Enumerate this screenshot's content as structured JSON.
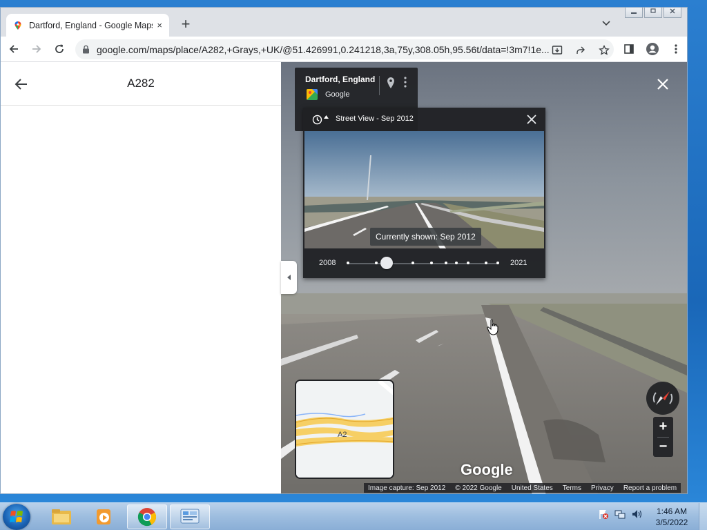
{
  "browser": {
    "tab": {
      "title": "Dartford, England - Google Maps",
      "close_icon": "×"
    },
    "new_tab_label": "+",
    "url": "google.com/maps/place/A282,+Grays,+UK/@51.426991,0.241218,3a,75y,308.05h,95.56t/data=!3m7!1e..."
  },
  "left_panel": {
    "title": "A282"
  },
  "street_view": {
    "info_card": {
      "place": "Dartford, England",
      "source": "Google"
    },
    "timeline": {
      "title": "Street View - Sep 2012",
      "tooltip": "Currently shown: Sep 2012",
      "year_start": "2008",
      "year_end": "2021"
    },
    "minimap_label": "A2",
    "logo_text": "Google",
    "attribution": {
      "capture": "Image capture: Sep 2012",
      "copyright": "© 2022 Google",
      "region": "United States",
      "terms": "Terms",
      "privacy": "Privacy",
      "report": "Report a problem"
    }
  },
  "taskbar": {
    "time": "1:46 AM",
    "date": "3/5/2022"
  },
  "colors": {
    "chrome_tabstrip": "#dee1e6",
    "overlay_dark": "#202124",
    "taskbar": "#9dbddf"
  }
}
